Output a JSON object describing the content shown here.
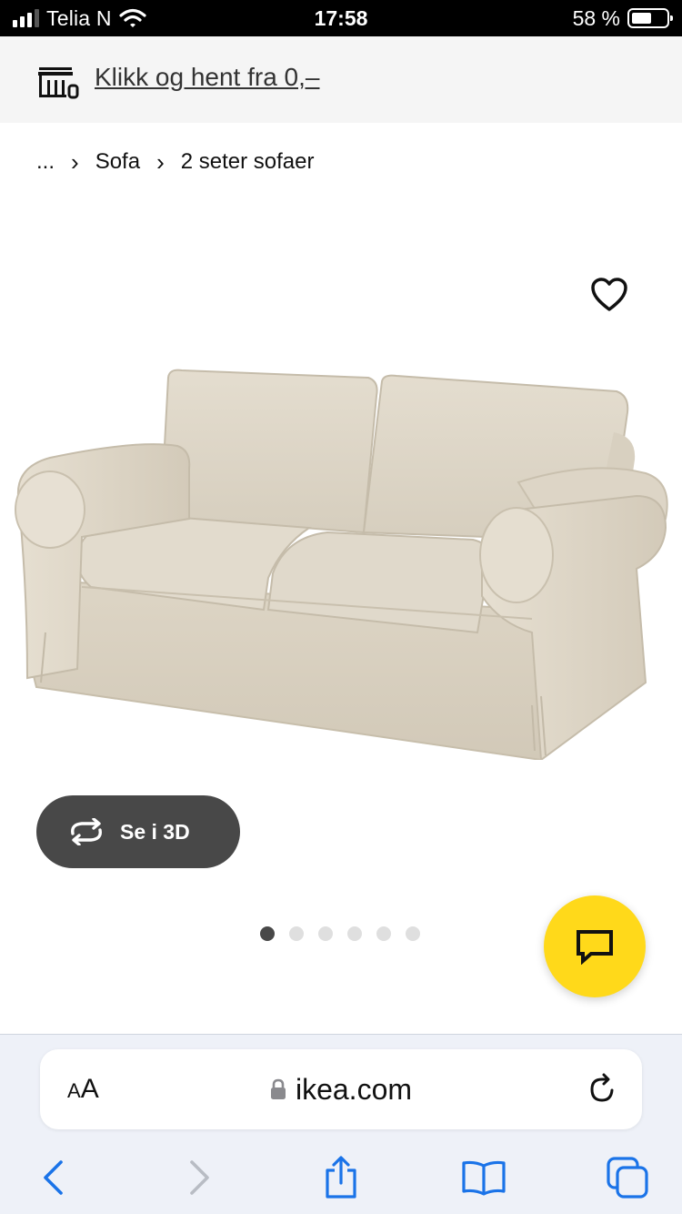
{
  "status_bar": {
    "carrier": "Telia N",
    "time": "17:58",
    "battery": "58 %",
    "battery_level": 0.58,
    "signal_bars": 3,
    "signal_bars_total": 4
  },
  "promo": {
    "text": "Klikk og hent fra 0,–",
    "icon": "store-pickup-icon"
  },
  "breadcrumb": {
    "items": [
      "...",
      "Sofa",
      "2 seter sofaer"
    ],
    "separator": "›"
  },
  "product": {
    "image": "sofa-image",
    "wishlist_icon": "heart-icon",
    "view_3d_label": "Se i 3D",
    "view_3d_icon": "rotate-icon"
  },
  "carousel": {
    "total": 6,
    "active_index": 0
  },
  "chat": {
    "icon": "chat-icon",
    "color": "#ffd91a"
  },
  "browser": {
    "text_size_label": "AA",
    "domain": "ikea.com",
    "lock_icon": "lock-icon",
    "reload_icon": "reload-icon",
    "toolbar": [
      "back-icon",
      "forward-icon",
      "share-icon",
      "bookmarks-icon",
      "tabs-icon"
    ],
    "accent": "#1a73e8"
  }
}
